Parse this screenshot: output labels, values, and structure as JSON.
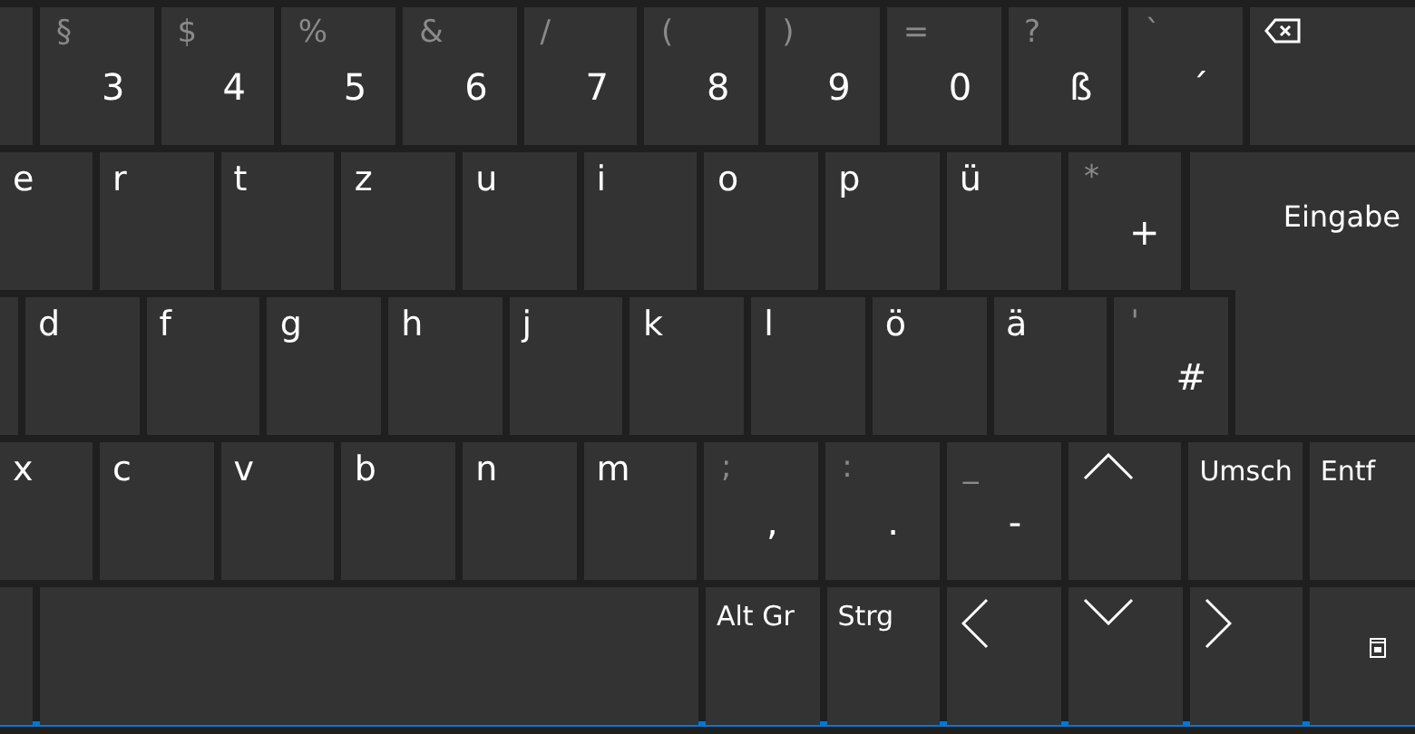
{
  "rows": [
    {
      "keys": [
        {
          "kind": "blank"
        },
        {
          "kind": "char",
          "shift": "§",
          "main": "3"
        },
        {
          "kind": "char",
          "shift": "$",
          "main": "4"
        },
        {
          "kind": "char",
          "shift": "%",
          "main": "5"
        },
        {
          "kind": "char",
          "shift": "&",
          "main": "6"
        },
        {
          "kind": "char",
          "shift": "/",
          "main": "7"
        },
        {
          "kind": "char",
          "shift": "(",
          "main": "8"
        },
        {
          "kind": "char",
          "shift": ")",
          "main": "9"
        },
        {
          "kind": "char",
          "shift": "=",
          "main": "0"
        },
        {
          "kind": "char",
          "shift": "?",
          "main": "ß"
        },
        {
          "kind": "char",
          "shift": "`",
          "main": "´"
        },
        {
          "kind": "backspace"
        }
      ]
    },
    {
      "keys": [
        {
          "kind": "letter",
          "main": "e"
        },
        {
          "kind": "letter",
          "main": "r"
        },
        {
          "kind": "letter",
          "main": "t"
        },
        {
          "kind": "letter",
          "main": "z"
        },
        {
          "kind": "letter",
          "main": "u"
        },
        {
          "kind": "letter",
          "main": "i"
        },
        {
          "kind": "letter",
          "main": "o"
        },
        {
          "kind": "letter",
          "main": "p"
        },
        {
          "kind": "letter",
          "main": "ü"
        },
        {
          "kind": "char",
          "shift": "*",
          "main": "+"
        },
        {
          "kind": "enter",
          "main": "Eingabe"
        }
      ]
    },
    {
      "keys": [
        {
          "kind": "blank"
        },
        {
          "kind": "letter",
          "main": "d"
        },
        {
          "kind": "letter",
          "main": "f"
        },
        {
          "kind": "letter",
          "main": "g"
        },
        {
          "kind": "letter",
          "main": "h"
        },
        {
          "kind": "letter",
          "main": "j"
        },
        {
          "kind": "letter",
          "main": "k"
        },
        {
          "kind": "letter",
          "main": "l"
        },
        {
          "kind": "letter",
          "main": "ö"
        },
        {
          "kind": "letter",
          "main": "ä"
        },
        {
          "kind": "char",
          "shift": "'",
          "main": "#"
        }
      ]
    },
    {
      "keys": [
        {
          "kind": "letter",
          "main": "x"
        },
        {
          "kind": "letter",
          "main": "c"
        },
        {
          "kind": "letter",
          "main": "v"
        },
        {
          "kind": "letter",
          "main": "b"
        },
        {
          "kind": "letter",
          "main": "n"
        },
        {
          "kind": "letter",
          "main": "m"
        },
        {
          "kind": "char",
          "shift": ";",
          "main": ","
        },
        {
          "kind": "char",
          "shift": ":",
          "main": "."
        },
        {
          "kind": "char",
          "shift": "_",
          "main": "-"
        },
        {
          "kind": "up"
        },
        {
          "kind": "label",
          "main": "Umsch"
        },
        {
          "kind": "label",
          "main": "Entf"
        }
      ]
    },
    {
      "keys": [
        {
          "kind": "blank"
        },
        {
          "kind": "blank"
        },
        {
          "kind": "label",
          "main": "Alt Gr"
        },
        {
          "kind": "label",
          "main": "Strg"
        },
        {
          "kind": "left"
        },
        {
          "kind": "down"
        },
        {
          "kind": "right"
        },
        {
          "kind": "dock"
        }
      ]
    }
  ]
}
